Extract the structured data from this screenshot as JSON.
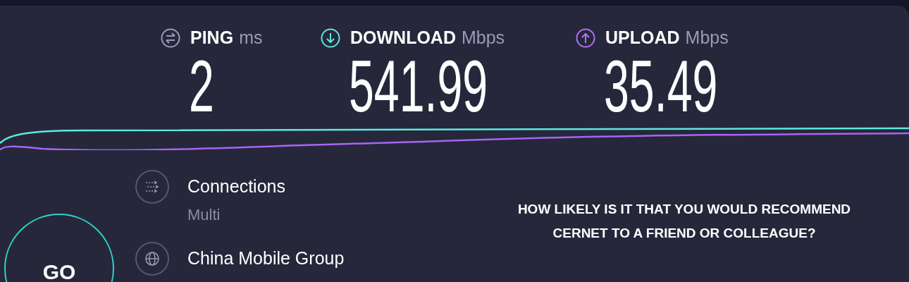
{
  "metrics": [
    {
      "kind": "ping",
      "label": "PING",
      "unit": "ms",
      "value": "2"
    },
    {
      "kind": "download",
      "label": "DOWNLOAD",
      "unit": "Mbps",
      "value": "541.99"
    },
    {
      "kind": "upload",
      "label": "UPLOAD",
      "unit": "Mbps",
      "value": "35.49"
    }
  ],
  "go_button": {
    "label": "GO"
  },
  "details": [
    {
      "kind": "connections",
      "title": "Connections",
      "subtitle": "Multi"
    },
    {
      "kind": "provider",
      "title": "China Mobile Group"
    }
  ],
  "survey": {
    "question": "HOW LIKELY IS IT THAT YOU WOULD RECOMMEND CERNET TO A FRIEND OR COLLEAGUE?"
  }
}
